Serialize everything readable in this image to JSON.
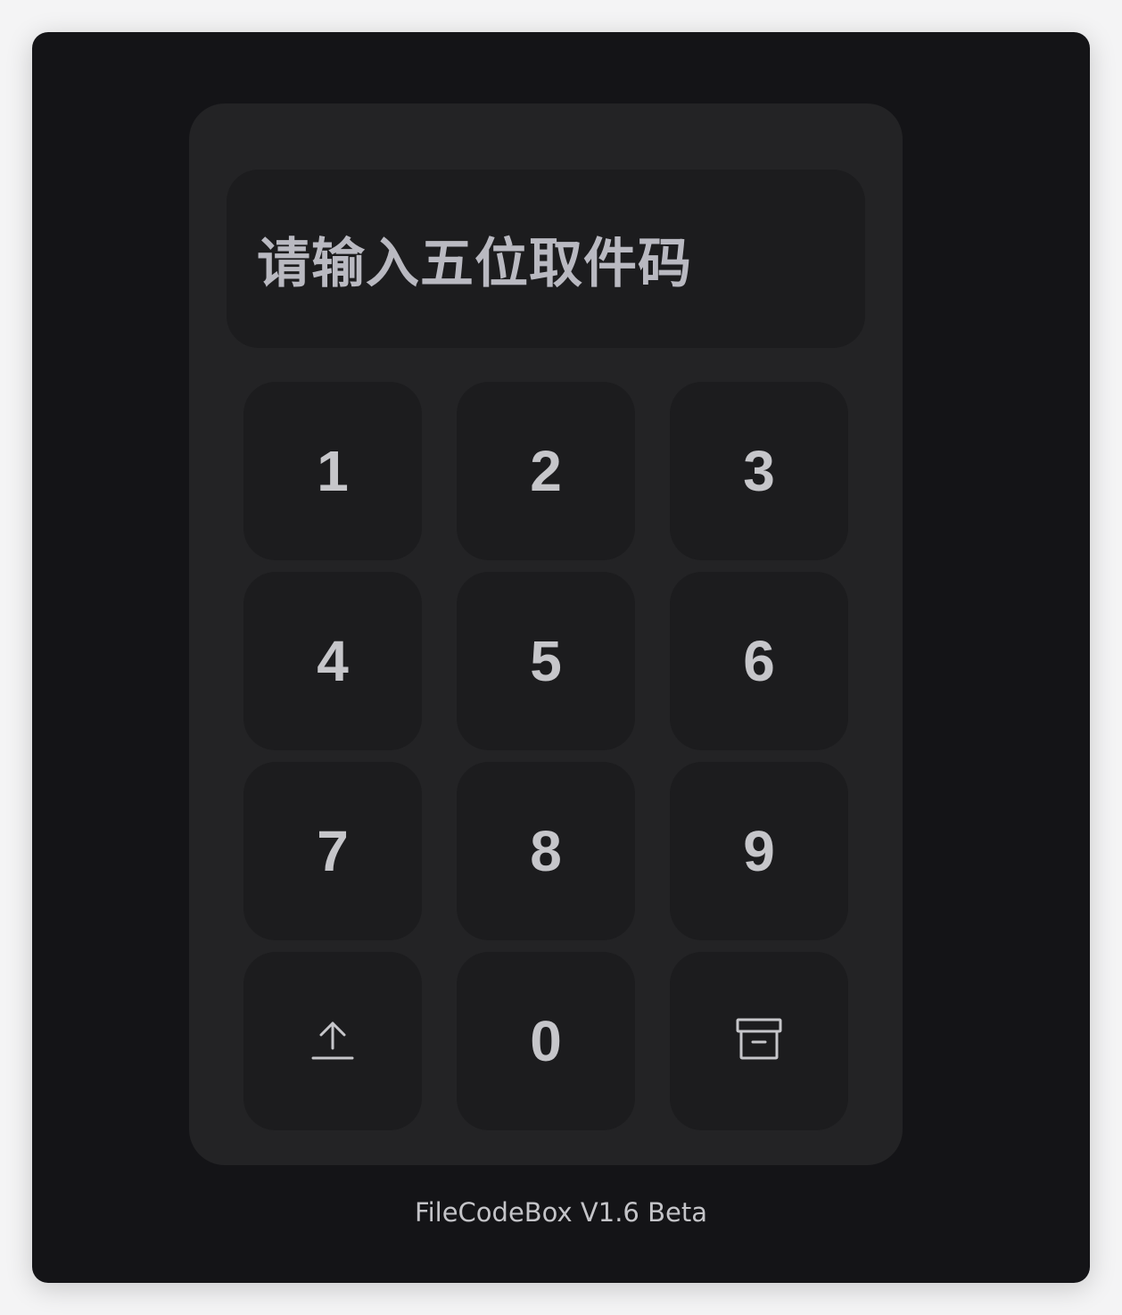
{
  "code_display": {
    "placeholder": "请输入五位取件码"
  },
  "keypad": {
    "keys": [
      {
        "label": "1"
      },
      {
        "label": "2"
      },
      {
        "label": "3"
      },
      {
        "label": "4"
      },
      {
        "label": "5"
      },
      {
        "label": "6"
      },
      {
        "label": "7"
      },
      {
        "label": "8"
      },
      {
        "label": "9"
      },
      {
        "icon": "upload-icon"
      },
      {
        "label": "0"
      },
      {
        "icon": "archive-box-icon"
      }
    ]
  },
  "footer": {
    "version_text": "FileCodeBox V1.6 Beta"
  },
  "colors": {
    "background": "#141417",
    "panel": "#232325",
    "key": "#1c1c1e",
    "text": "#c6c6ca"
  }
}
